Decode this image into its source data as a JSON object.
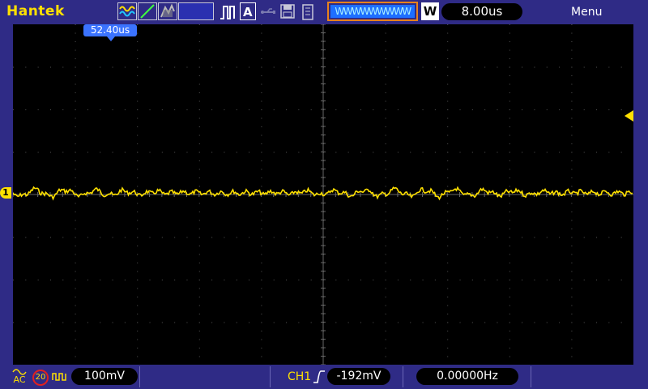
{
  "header": {
    "brand": "Hantek",
    "waveform_label": "WWWWWWWWW",
    "mode_letter": "W",
    "timebase": "8.00us",
    "menu": "Menu"
  },
  "markers": {
    "trigger_time": "52.40us",
    "channel_marker": "1"
  },
  "footer": {
    "coupling": "AC",
    "bw_limit": "20",
    "volts_div": "100mV",
    "trigger_source": "CH1",
    "trigger_level": "-192mV",
    "frequency": "0.00000Hz"
  },
  "colors": {
    "trace": "#ffe000",
    "background": "#2f2b86",
    "grid": "#3a3a3a",
    "accent": "#3b73ff"
  }
}
